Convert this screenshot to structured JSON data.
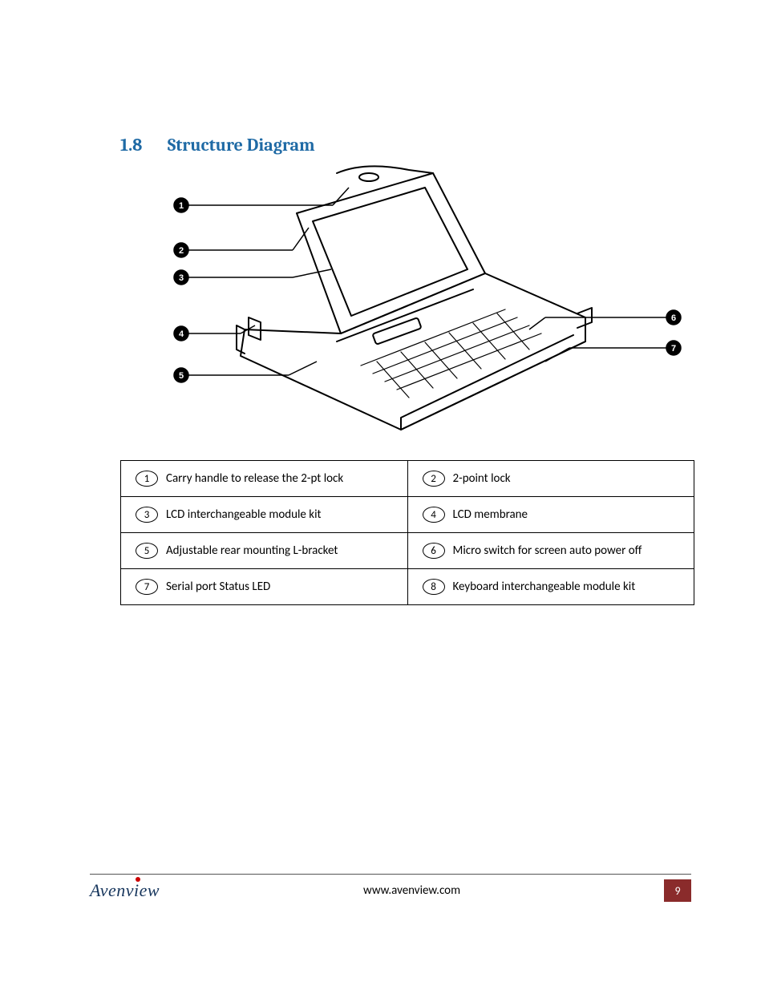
{
  "heading": {
    "number": "1.8",
    "title": "Structure Diagram"
  },
  "callouts": {
    "left": [
      "1",
      "2",
      "3",
      "4",
      "5"
    ],
    "right": [
      "6",
      "7"
    ]
  },
  "parts": [
    {
      "num": "1",
      "label": "Carry handle to release the 2-pt lock"
    },
    {
      "num": "2",
      "label": "2-point lock"
    },
    {
      "num": "3",
      "label": "LCD interchangeable module kit"
    },
    {
      "num": "4",
      "label": "LCD membrane"
    },
    {
      "num": "5",
      "label": "Adjustable rear mounting L-bracket"
    },
    {
      "num": "6",
      "label": "Micro switch for screen auto power off"
    },
    {
      "num": "7",
      "label": "Serial port Status LED"
    },
    {
      "num": "8",
      "label": "Keyboard interchangeable module kit"
    }
  ],
  "footer": {
    "brand": "Avenview",
    "url": "www.avenview.com",
    "page": "9"
  }
}
